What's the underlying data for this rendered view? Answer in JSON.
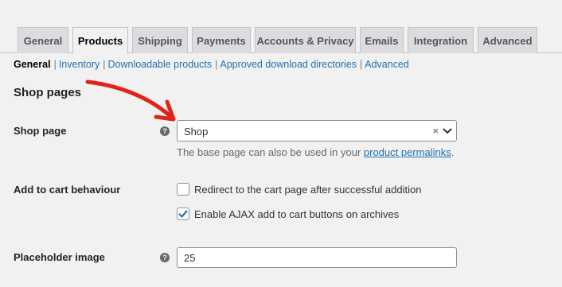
{
  "tabs": [
    {
      "label": "General"
    },
    {
      "label": "Products",
      "active": true
    },
    {
      "label": "Shipping"
    },
    {
      "label": "Payments"
    },
    {
      "label": "Accounts & Privacy"
    },
    {
      "label": "Emails"
    },
    {
      "label": "Integration"
    },
    {
      "label": "Advanced"
    }
  ],
  "subnav": {
    "current": "General",
    "links": [
      "Inventory",
      "Downloadable products",
      "Approved download directories",
      "Advanced"
    ],
    "separator": "|"
  },
  "section_title": "Shop pages",
  "shop_page": {
    "label": "Shop page",
    "help_icon": "question-circle-icon",
    "help_glyph": "?",
    "value": "Shop",
    "clear_glyph": "×",
    "description_prefix": "The base page can also be used in your ",
    "description_link": "product permalinks",
    "description_suffix": "."
  },
  "add_to_cart": {
    "label": "Add to cart behaviour",
    "options": [
      {
        "label": "Redirect to the cart page after successful addition",
        "checked": false
      },
      {
        "label": "Enable AJAX add to cart buttons on archives",
        "checked": true
      }
    ]
  },
  "placeholder_image": {
    "label": "Placeholder image",
    "help_icon": "question-circle-icon",
    "help_glyph": "?",
    "value": "25"
  },
  "colors": {
    "link": "#2271b1",
    "checkbox_accent": "#2271b1",
    "annotation_arrow": "#e2231a"
  }
}
